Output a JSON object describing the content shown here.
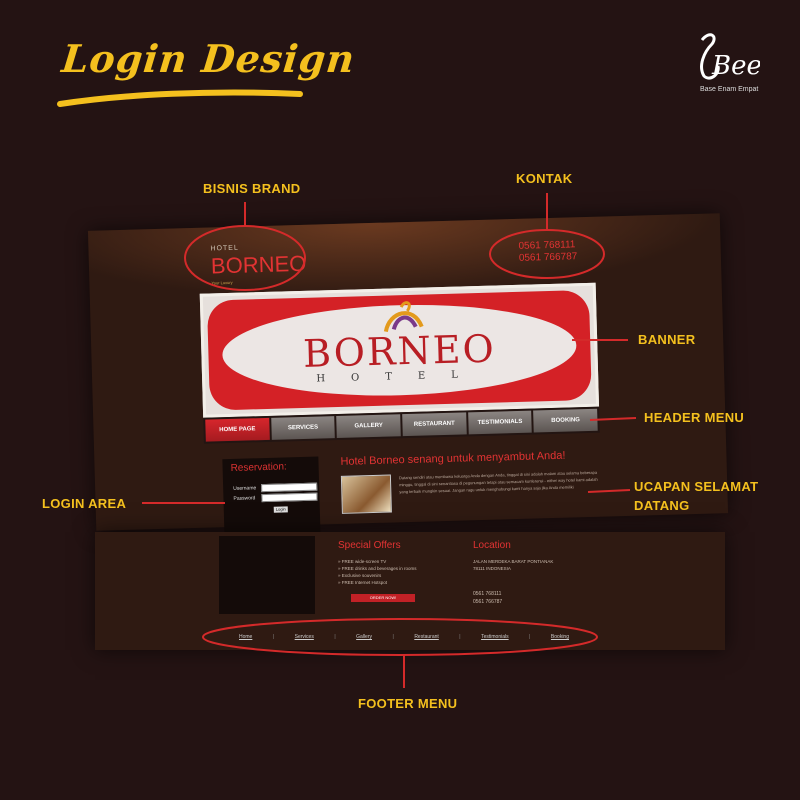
{
  "poster": {
    "title": "Login Design",
    "logo_tagline": "Base Enam Empat",
    "colors": {
      "accent": "#f4c01e",
      "highlight": "#d42a2a",
      "background": "#241313"
    }
  },
  "site": {
    "brand_small": "HOTEL",
    "brand_name": "BORNEO",
    "brand_tagline": "Your Luxury",
    "contact": {
      "phone1": "0561 768111",
      "phone2": "0561 766787"
    },
    "banner": {
      "word": "BORNEO",
      "subword": "HOTEL"
    },
    "nav": [
      "HOME PAGE",
      "SERVICES",
      "GALLERY",
      "RESTAURANT",
      "TESTIMONIALS",
      "BOOKING"
    ],
    "login": {
      "title": "Reservation:",
      "username_label": "Username",
      "password_label": "Password",
      "button": "Login"
    },
    "welcome": {
      "title": "Hotel Borneo senang untuk menyambut Anda!",
      "text": "Datang sendiri atau membawa keluarga Anda dengan Anda, tinggal di sini adalah malam atau selama beberapa minggu, tinggal di sini senantiasa di pegunungan tetapi atau semacam konferensi - either way hotel kami adalah yang terbaik mungkin sesuai. Jangan ragu untuk menghubungi kami hanya saja jika Anda memiliki"
    },
    "offers": {
      "title": "Special Offers",
      "items": [
        "FREE wide-screen TV",
        "FREE drinks and beverages in rooms",
        "Exclusive souvenirs",
        "FREE Internet Hotspot"
      ],
      "button": "ORDER NOW!"
    },
    "location": {
      "title": "Location",
      "address1": "JALAN MERDEKA BARAT PONTIANAK",
      "address2": "78111 INDONESIA",
      "phone1": "0561 768111",
      "phone2": "0561 766787"
    },
    "footer": [
      "Home",
      "Services",
      "Gallery",
      "Restaurant",
      "Testimonials",
      "Booking"
    ]
  },
  "annotations": {
    "brand": "BISNIS BRAND",
    "contact": "KONTAK",
    "banner": "BANNER",
    "header_menu": "HEADER MENU",
    "greeting_line1": "UCAPAN SELAMAT",
    "greeting_line2": "DATANG",
    "login": "LOGIN AREA",
    "footer": "FOOTER MENU"
  }
}
